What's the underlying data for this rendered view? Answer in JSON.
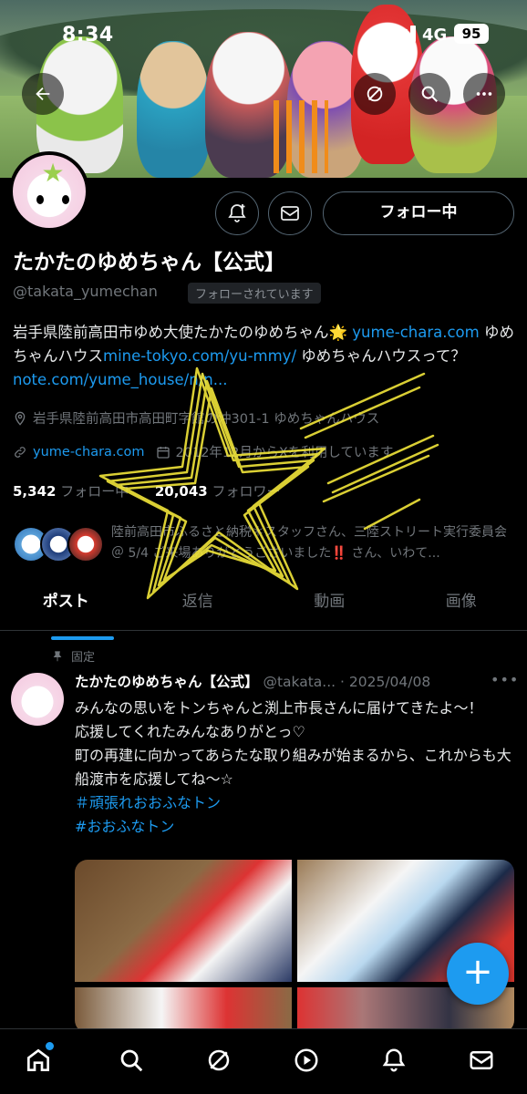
{
  "status_bar": {
    "time": "8:34",
    "network": "4G",
    "battery": "95"
  },
  "profile": {
    "name": "たかたのゆめちゃん【公式】",
    "handle": "@takata_yumechan",
    "follows_you_badge": "フォローされています",
    "follow_button": "フォロー中",
    "bio_parts": [
      {
        "text": "岩手県陸前高田市ゆめ大使たかたのゆめちゃん🌟 "
      },
      {
        "link": "yume-chara.com"
      },
      {
        "text": " ゆめちゃんハウス"
      },
      {
        "link": "mine-tokyo.com/yu-mmy/"
      },
      {
        "text": " ゆめちゃんハウスって？"
      },
      {
        "link": "note.com/yume_house/n/n..."
      }
    ],
    "location": "岩手県陸前高田市高田町字館の沖301-1 ゆめちゃんハウス",
    "website": "yume-chara.com",
    "joined": "2012年12月からXを利用しています",
    "following_count": "5,342",
    "following_label": "フォロー中",
    "followers_count": "20,043",
    "followers_label": "フォロワー",
    "known_followers_text": "陸前高田市ふるさと納税＊スタッフさん、三陸ストリート実行委員会＠ 5/4 ご来場ありがとうございました‼️ さん、いわて..."
  },
  "tabs": [
    {
      "label": "ポスト",
      "active": true
    },
    {
      "label": "返信",
      "active": false
    },
    {
      "label": "動画",
      "active": false
    },
    {
      "label": "画像",
      "active": false
    }
  ],
  "post": {
    "pinned_label": "固定",
    "author": "たかたのゆめちゃん【公式】",
    "handle": "@takata...",
    "date": "· 2025/04/08",
    "body_lines": [
      "みんなの思いをトンちゃんと渕上市長さんに届けてきたよ〜！",
      "応援してくれたみんなありがとっ♡",
      "町の再建に向かってあらたな取り組みが始まるから、これからも大船渡市を応援してね〜☆"
    ],
    "hashtags": [
      "＃頑張れおおふなトン",
      "#おおふなトン"
    ]
  },
  "colors": {
    "accent": "#1d9bf0",
    "background": "#000000",
    "muted": "#71767b",
    "doodle": "#f2e63a"
  },
  "icons": {
    "back": "arrow-left-icon",
    "grok": "grok-icon",
    "search": "search-icon",
    "more": "more-icon",
    "notify": "bell-plus-icon",
    "message": "envelope-icon",
    "location": "location-pin-icon",
    "link": "link-icon",
    "calendar": "calendar-icon",
    "pin": "pin-icon",
    "compose": "plus-icon"
  },
  "bottom_nav": [
    "home-icon",
    "search-icon",
    "grok-icon",
    "video-icon",
    "bell-icon",
    "envelope-icon"
  ]
}
